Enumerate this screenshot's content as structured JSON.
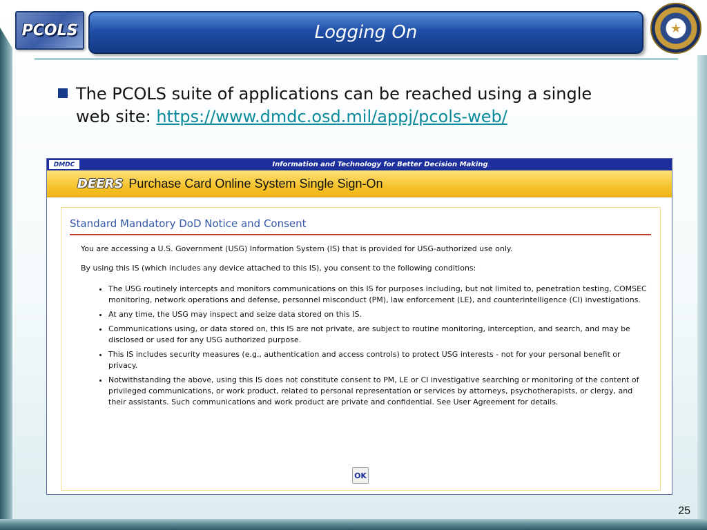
{
  "slide": {
    "logo_text": "PCOLS",
    "title": "Logging On",
    "bullet_text": "The PCOLS suite of applications can be reached using a single web site: ",
    "bullet_link": "https://www.dmdc.osd.mil/appj/pcols-web/",
    "page_number": "25"
  },
  "screenshot": {
    "badge": "DMDC",
    "tagline": "Information and Technology for Better Decision Making",
    "deers_logo": "DEERS",
    "system_title": "Purchase Card Online System Single Sign-On",
    "notice": {
      "heading": "Standard Mandatory DoD Notice and Consent",
      "intro": "You are accessing a U.S. Government (USG) Information System (IS) that is provided for USG-authorized use only.",
      "consent": "By using this IS (which includes any device attached to this IS), you consent to the following conditions:",
      "conditions": [
        "The USG routinely intercepts and monitors communications on this IS for purposes including, but not limited to, penetration testing, COMSEC monitoring, network operations and defense, personnel misconduct (PM), law enforcement (LE), and counterintelligence (CI) investigations.",
        "At any time, the USG may inspect and seize data stored on this IS.",
        "Communications using, or data stored on, this IS are not private, are subject to routine monitoring, interception, and search, and may be disclosed or used for any USG authorized purpose.",
        "This IS includes security measures (e.g., authentication and access controls) to protect USG interests - not for your personal benefit or privacy.",
        "Notwithstanding the above, using this IS does not constitute consent to PM, LE or CI investigative searching or monitoring of the content of privileged communications, or work product, related to personal representation or services by attorneys, psychotherapists, or clergy, and their assistants. Such communications and work product are private and confidential. See User Agreement for details."
      ],
      "ok_label": "OK"
    }
  }
}
